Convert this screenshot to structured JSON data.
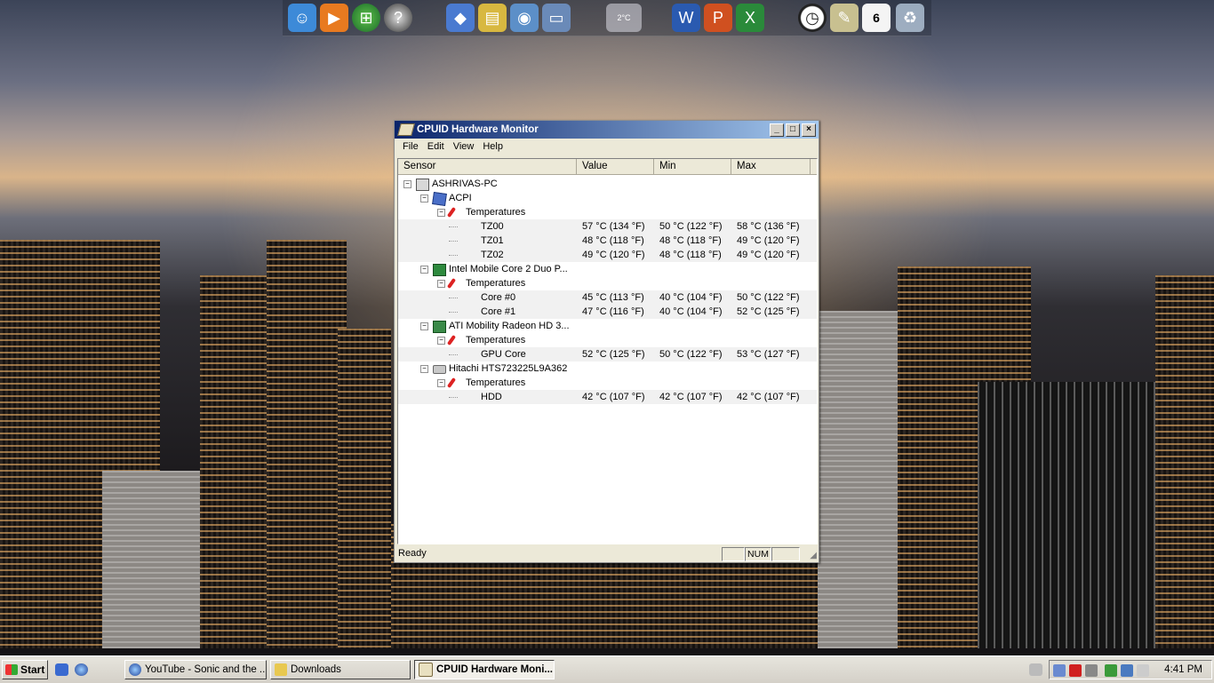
{
  "dock": {
    "icons": [
      "messenger-icon",
      "media-player-icon",
      "windows-orb-icon",
      "help-icon",
      "network-icon",
      "folders-icon",
      "internet-icon",
      "computer-icon",
      "weather-widget-icon",
      "word-icon",
      "powerpoint-icon",
      "excel-icon",
      "clock-widget-icon",
      "notes-icon",
      "calendar-icon",
      "recycle-bin-icon"
    ],
    "weather_temp": "2°C",
    "calendar_day": "6"
  },
  "window": {
    "title": "CPUID Hardware Monitor",
    "menu": [
      "File",
      "Edit",
      "View",
      "Help"
    ],
    "columns": [
      "Sensor",
      "Value",
      "Min",
      "Max"
    ],
    "tree": [
      {
        "label": "ASHRIVAS-PC",
        "level": 0,
        "icon": "computer-icon",
        "expander": "−"
      },
      {
        "label": "ACPI",
        "level": 1,
        "icon": "acpi-cube-icon",
        "expander": "−"
      },
      {
        "label": "Temperatures",
        "level": 2,
        "icon": "thermometer-icon",
        "expander": "−"
      },
      {
        "label": "TZ00",
        "level": 3,
        "value": "57 °C  (134 °F)",
        "min": "50 °C  (122 °F)",
        "max": "58 °C  (136 °F)"
      },
      {
        "label": "TZ01",
        "level": 3,
        "value": "48 °C  (118 °F)",
        "min": "48 °C  (118 °F)",
        "max": "49 °C  (120 °F)"
      },
      {
        "label": "TZ02",
        "level": 3,
        "value": "49 °C  (120 °F)",
        "min": "48 °C  (118 °F)",
        "max": "49 °C  (120 °F)"
      },
      {
        "label": "Intel Mobile Core 2 Duo P...",
        "level": 1,
        "icon": "cpu-chip-icon",
        "expander": "−"
      },
      {
        "label": "Temperatures",
        "level": 2,
        "icon": "thermometer-icon",
        "expander": "−"
      },
      {
        "label": "Core #0",
        "level": 3,
        "value": "45 °C  (113 °F)",
        "min": "40 °C  (104 °F)",
        "max": "50 °C  (122 °F)"
      },
      {
        "label": "Core #1",
        "level": 3,
        "value": "47 °C  (116 °F)",
        "min": "40 °C  (104 °F)",
        "max": "52 °C  (125 °F)"
      },
      {
        "label": "ATI Mobility Radeon HD 3...",
        "level": 1,
        "icon": "gpu-card-icon",
        "expander": "−"
      },
      {
        "label": "Temperatures",
        "level": 2,
        "icon": "thermometer-icon",
        "expander": "−"
      },
      {
        "label": "GPU Core",
        "level": 3,
        "value": "52 °C  (125 °F)",
        "min": "50 °C  (122 °F)",
        "max": "53 °C  (127 °F)"
      },
      {
        "label": "Hitachi HTS723225L9A362",
        "level": 1,
        "icon": "hard-drive-icon",
        "expander": "−"
      },
      {
        "label": "Temperatures",
        "level": 2,
        "icon": "thermometer-icon",
        "expander": "−"
      },
      {
        "label": "HDD",
        "level": 3,
        "value": "42 °C  (107 °F)",
        "min": "42 °C  (107 °F)",
        "max": "42 °C  (107 °F)"
      }
    ],
    "status": {
      "ready": "Ready",
      "num": "NUM"
    }
  },
  "taskbar": {
    "start_label": "Start",
    "tasks": [
      {
        "label": "YouTube - Sonic and the ...",
        "icon": "browser-icon",
        "active": false
      },
      {
        "label": "Downloads",
        "icon": "folder-icon",
        "active": false
      },
      {
        "label": "CPUID Hardware Moni...",
        "icon": "cpuid-icon",
        "active": true
      }
    ],
    "clock": "4:41 PM"
  }
}
